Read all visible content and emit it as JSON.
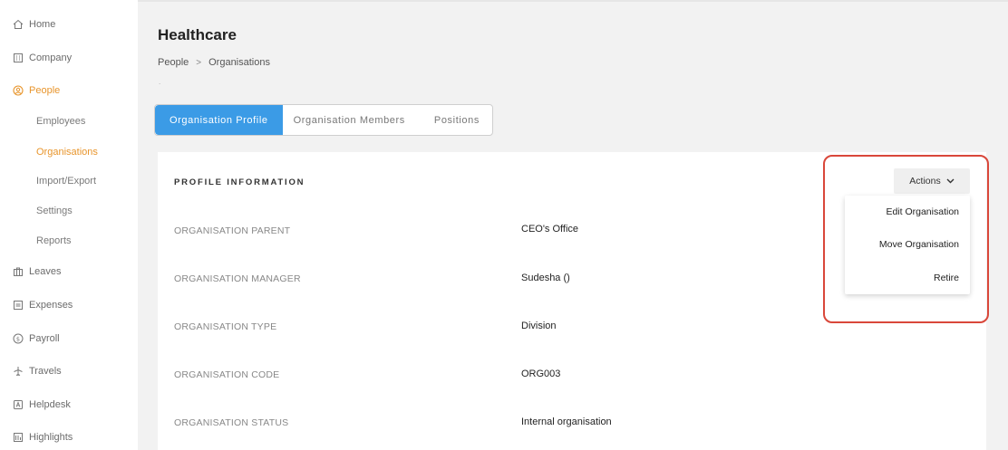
{
  "sidebar": {
    "items": [
      {
        "label": "Home",
        "icon": "home-icon"
      },
      {
        "label": "Company",
        "icon": "building-icon"
      },
      {
        "label": "People",
        "icon": "people-icon"
      },
      {
        "label": "Leaves",
        "icon": "suitcase-icon"
      },
      {
        "label": "Expenses",
        "icon": "receipt-icon"
      },
      {
        "label": "Payroll",
        "icon": "coin-icon"
      },
      {
        "label": "Travels",
        "icon": "plane-icon"
      },
      {
        "label": "Helpdesk",
        "icon": "ticket-icon"
      },
      {
        "label": "Highlights",
        "icon": "highlights-icon"
      }
    ],
    "people_sub": [
      {
        "label": "Employees"
      },
      {
        "label": "Organisations"
      },
      {
        "label": "Import/Export"
      },
      {
        "label": "Settings"
      },
      {
        "label": "Reports"
      }
    ]
  },
  "header": {
    "title": "Healthcare",
    "breadcrumb": [
      "People",
      "Organisations"
    ],
    "breadcrumb_sep": ">",
    "dot": "."
  },
  "tabs": [
    {
      "label": "Organisation Profile"
    },
    {
      "label": "Organisation Members"
    },
    {
      "label": "Positions"
    }
  ],
  "profile": {
    "section_title": "PROFILE INFORMATION",
    "rows": [
      {
        "label": "ORGANISATION PARENT",
        "value": "CEO's Office"
      },
      {
        "label": "ORGANISATION MANAGER",
        "value": "Sudesha ()"
      },
      {
        "label": "ORGANISATION TYPE",
        "value": "Division"
      },
      {
        "label": "ORGANISATION CODE",
        "value": "ORG003"
      },
      {
        "label": "ORGANISATION STATUS",
        "value": "Internal organisation"
      }
    ]
  },
  "actions": {
    "label": "Actions",
    "menu": [
      "Edit Organisation",
      "Move Organisation",
      "Retire"
    ]
  },
  "colors": {
    "accent": "#e8952c",
    "tab_active": "#3b9be6",
    "highlight": "#d9473a"
  }
}
